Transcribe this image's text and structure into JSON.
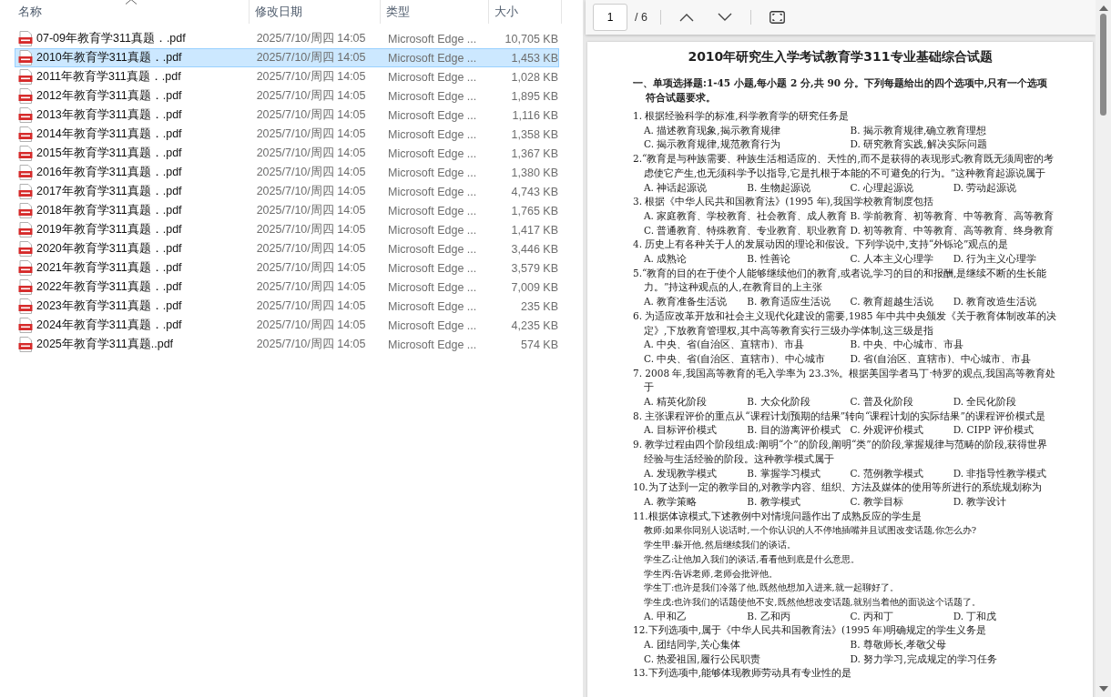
{
  "file_list": {
    "columns": [
      {
        "label": "名称",
        "sorted": true
      },
      {
        "label": "修改日期",
        "sorted": false
      },
      {
        "label": "类型",
        "sorted": false
      },
      {
        "label": "大小",
        "sorted": false
      }
    ],
    "files": [
      {
        "name": "07-09年教育学311真题．.pdf",
        "modified": "2025/7/10/周四 14:05",
        "type": "Microsoft Edge ...",
        "size": "10,705 KB",
        "selected": false
      },
      {
        "name": "2010年教育学311真题．.pdf",
        "modified": "2025/7/10/周四 14:05",
        "type": "Microsoft Edge ...",
        "size": "1,453 KB",
        "selected": true
      },
      {
        "name": "2011年教育学311真题．.pdf",
        "modified": "2025/7/10/周四 14:05",
        "type": "Microsoft Edge ...",
        "size": "1,028 KB",
        "selected": false
      },
      {
        "name": "2012年教育学311真题．.pdf",
        "modified": "2025/7/10/周四 14:05",
        "type": "Microsoft Edge ...",
        "size": "1,895 KB",
        "selected": false
      },
      {
        "name": "2013年教育学311真题．.pdf",
        "modified": "2025/7/10/周四 14:05",
        "type": "Microsoft Edge ...",
        "size": "1,116 KB",
        "selected": false
      },
      {
        "name": "2014年教育学311真题．.pdf",
        "modified": "2025/7/10/周四 14:05",
        "type": "Microsoft Edge ...",
        "size": "1,358 KB",
        "selected": false
      },
      {
        "name": "2015年教育学311真题．.pdf",
        "modified": "2025/7/10/周四 14:05",
        "type": "Microsoft Edge ...",
        "size": "1,367 KB",
        "selected": false
      },
      {
        "name": "2016年教育学311真题．.pdf",
        "modified": "2025/7/10/周四 14:05",
        "type": "Microsoft Edge ...",
        "size": "1,380 KB",
        "selected": false
      },
      {
        "name": "2017年教育学311真题．.pdf",
        "modified": "2025/7/10/周四 14:05",
        "type": "Microsoft Edge ...",
        "size": "4,743 KB",
        "selected": false
      },
      {
        "name": "2018年教育学311真题．.pdf",
        "modified": "2025/7/10/周四 14:05",
        "type": "Microsoft Edge ...",
        "size": "1,765 KB",
        "selected": false
      },
      {
        "name": "2019年教育学311真题．.pdf",
        "modified": "2025/7/10/周四 14:05",
        "type": "Microsoft Edge ...",
        "size": "1,417 KB",
        "selected": false
      },
      {
        "name": "2020年教育学311真题．.pdf",
        "modified": "2025/7/10/周四 14:05",
        "type": "Microsoft Edge ...",
        "size": "3,446 KB",
        "selected": false
      },
      {
        "name": "2021年教育学311真题．.pdf",
        "modified": "2025/7/10/周四 14:05",
        "type": "Microsoft Edge ...",
        "size": "3,579 KB",
        "selected": false
      },
      {
        "name": "2022年教育学311真题．.pdf",
        "modified": "2025/7/10/周四 14:05",
        "type": "Microsoft Edge ...",
        "size": "7,009 KB",
        "selected": false
      },
      {
        "name": "2023年教育学311真题．.pdf",
        "modified": "2025/7/10/周四 14:05",
        "type": "Microsoft Edge ...",
        "size": "235 KB",
        "selected": false
      },
      {
        "name": "2024年教育学311真题．.pdf",
        "modified": "2025/7/10/周四 14:05",
        "type": "Microsoft Edge ...",
        "size": "4,235 KB",
        "selected": false
      },
      {
        "name": "2025年教育学311真题..pdf",
        "modified": "2025/7/10/周四 14:05",
        "type": "Microsoft Edge ...",
        "size": "574 KB",
        "selected": false
      }
    ]
  },
  "viewer": {
    "toolbar": {
      "page_number": "1",
      "page_count": "/ 6"
    },
    "document": {
      "title": "2010年研究生入学考试教育学311专业基础综合试题",
      "section_heading": "一、单项选择题:1-45 小题,每小题 2 分,共 90 分。下列每题给出的四个选项中,只有一个选项符合试题要求。",
      "questions": [
        {
          "stem": "1. 根据经验科学的标准,科学教育学的研究任务是",
          "kind": "two",
          "options": [
            "A. 描述教育现象,揭示教育规律",
            "B. 揭示教育规律,确立教育理想",
            "C. 揭示教育规律,规范教育行为",
            "D. 研究教育实践,解决实际问题"
          ]
        },
        {
          "stem": "2.“教育是与种族需要、种族生活相适应的、天性的,而不是获得的表现形式;教育既无须周密的考虑使它产生,也无须科学予以指导,它是扎根于本能的不可避免的行为。”这种教育起源说属于",
          "kind": "four",
          "options": [
            "A. 神话起源说",
            "B. 生物起源说",
            "C. 心理起源说",
            "D. 劳动起源说"
          ]
        },
        {
          "stem": "3. 根据《中华人民共和国教育法》(1995 年),我国学校教育制度包括",
          "kind": "two",
          "options": [
            "A. 家庭教育、学校教育、社会教育、成人教育",
            "B. 学前教育、初等教育、中等教育、高等教育",
            "C. 普通教育、特殊教育、专业教育、职业教育",
            "D. 初等教育、中等教育、高等教育、终身教育"
          ]
        },
        {
          "stem": "4. 历史上有各种关于人的发展动因的理论和假设。下列学说中,支持“外铄论”观点的是",
          "kind": "four",
          "options": [
            "A. 成熟论",
            "B. 性善论",
            "C. 人本主义心理学",
            "D. 行为主义心理学"
          ]
        },
        {
          "stem": "5.“教育的目的在于使个人能够继续他们的教育,或者说,学习的目的和报酬,是继续不断的生长能力。”持这种观点的人,在教育目的上主张",
          "kind": "four",
          "options": [
            "A. 教育准备生活说",
            "B. 教育适应生活说",
            "C. 教育超越生活说",
            "D. 教育改造生活说"
          ]
        },
        {
          "stem": "6. 为适应改革开放和社会主义现代化建设的需要,1985 年中共中央颁发《关于教育体制改革的决定》,下放教育管理权,其中高等教育实行三级办学体制,这三级是指",
          "kind": "two",
          "options": [
            "A. 中央、省(自治区、直辖市)、市县",
            "B. 中央、中心城市、市县",
            "C. 中央、省(自治区、直辖市)、中心城市",
            "D. 省(自治区、直辖市)、中心城市、市县"
          ]
        },
        {
          "stem": "7. 2008 年,我国高等教育的毛入学率为 23.3%。根据美国学者马丁·特罗的观点,我国高等教育处于",
          "kind": "four",
          "options": [
            "A. 精英化阶段",
            "B. 大众化阶段",
            "C. 普及化阶段",
            "D. 全民化阶段"
          ]
        },
        {
          "stem": "8. 主张课程评价的重点从“课程计划预期的结果”转向“课程计划的实际结果”的课程评价模式是",
          "kind": "four",
          "options": [
            "A. 目标评价模式",
            "B. 目的游离评价模式",
            "C. 外观评价模式",
            "D. CIPP 评价模式"
          ]
        },
        {
          "stem": "9. 教学过程由四个阶段组成:阐明“个”的阶段,阐明“类”的阶段,掌握规律与范畴的阶段,获得世界经验与生活经验的阶段。这种教学模式属于",
          "kind": "four",
          "options": [
            "A. 发现教学模式",
            "B. 掌握学习模式",
            "C. 范例教学模式",
            "D. 非指导性教学模式"
          ]
        },
        {
          "stem": "10.为了达到一定的教学目的,对教学内容、组织、方法及媒体的使用等所进行的系统规划称为",
          "kind": "four",
          "options": [
            "A. 教学策略",
            "B. 教学模式",
            "C. 教学目标",
            "D. 教学设计"
          ]
        },
        {
          "stem": "11.根据体谅模式,下述教例中对情境问题作出了成熟反应的学生是",
          "dialogue": [
            "教师:如果你同别人说话时,一个你认识的人不停地插嘴并且试图改变话题,你怎么办?",
            "学生甲:躲开他,然后继续我们的谈话。",
            "学生乙:让他加入我们的谈话,看看他到底是什么意思。",
            "学生丙:告诉老师,老师会批评他。",
            "学生丁:也许是我们冷落了他,既然他想加入进来,就一起聊好了。",
            "学生戊:也许我们的话题使他不安,既然他想改变话题,就别当着他的面说这个话题了。"
          ],
          "kind": "four",
          "options": [
            "A. 甲和乙",
            "B. 乙和丙",
            "C. 丙和丁",
            "D. 丁和戊"
          ]
        },
        {
          "stem": "12.下列选项中,属于《中华人民共和国教育法》(1995 年)明确规定的学生义务是",
          "kind": "two",
          "options": [
            "A. 团结同学,关心集体",
            "B. 尊敬师长,孝敬父母",
            "C. 热爱祖国,履行公民职责",
            "D. 努力学习,完成规定的学习任务"
          ]
        },
        {
          "stem": "13.下列选项中,能够体现教师劳动具有专业性的是"
        }
      ]
    }
  }
}
